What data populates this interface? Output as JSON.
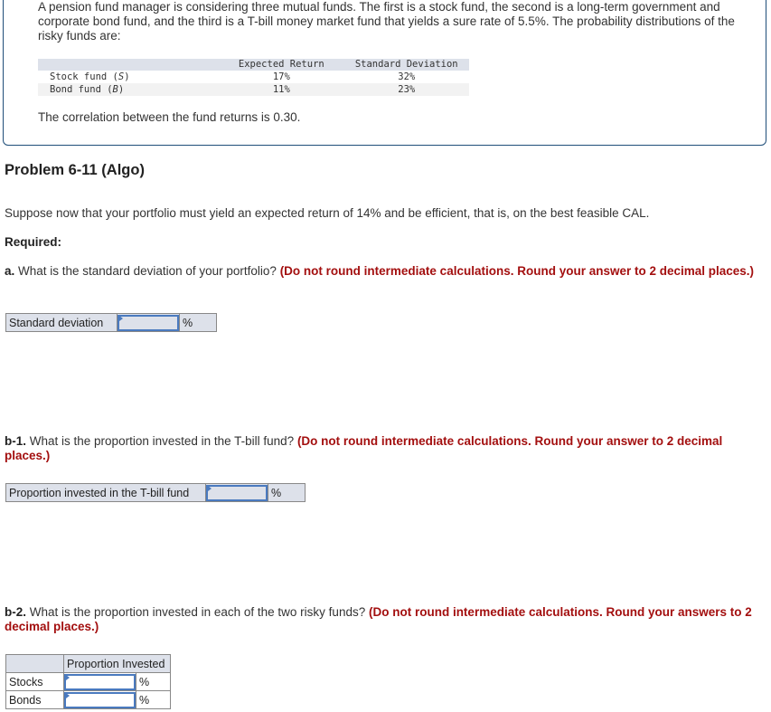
{
  "intro": {
    "text": "A pension fund manager is considering three mutual funds. The first is a stock fund, the second is a long-term government and corporate bond fund, and the third is a T-bill money market fund that yields a sure rate of 5.5%. The probability distributions of the risky funds are:",
    "table": {
      "headers": [
        "",
        "Expected Return",
        "Standard Deviation"
      ],
      "rows": [
        {
          "name": "Stock fund (",
          "symbol": "S",
          "close": ")",
          "expected_return": "17%",
          "std_dev": "32%"
        },
        {
          "name": "Bond fund (",
          "symbol": "B",
          "close": ")",
          "expected_return": "11%",
          "std_dev": "23%"
        }
      ]
    },
    "correlation": "The correlation between the fund returns is 0.30."
  },
  "problem": {
    "title": "Problem 6-11 (Algo)",
    "scenario": "Suppose now that your portfolio must yield an expected return of 14% and be efficient, that is, on the best feasible CAL.",
    "required": "Required:"
  },
  "part_a": {
    "prefix": "a.",
    "question": " What is the standard deviation of your portfolio? ",
    "instruction": "(Do not round intermediate calculations. Round your answer to 2 decimal places.)",
    "label": "Standard deviation",
    "value": "",
    "unit": "%"
  },
  "part_b1": {
    "prefix": "b-1.",
    "question": " What is the proportion invested in the T-bill fund? ",
    "instruction": "(Do not round intermediate calculations. Round your answer to 2 decimal places.)",
    "label": "Proportion invested in the T-bill fund",
    "value": "",
    "unit": "%"
  },
  "part_b2": {
    "prefix": "b-2.",
    "question": " What is the proportion invested in each of the two risky funds? ",
    "instruction": "(Do not round intermediate calculations. Round your answers to 2 decimal places.)",
    "header": "Proportion Invested",
    "rows": [
      {
        "label": "Stocks",
        "value": "",
        "unit": "%"
      },
      {
        "label": "Bonds",
        "value": "",
        "unit": "%"
      }
    ]
  },
  "colors": {
    "accent_border": "#1f4e79",
    "instruction_red": "#a30f0f",
    "input_border": "#4a7abf",
    "label_bg": "#dde1ea"
  }
}
